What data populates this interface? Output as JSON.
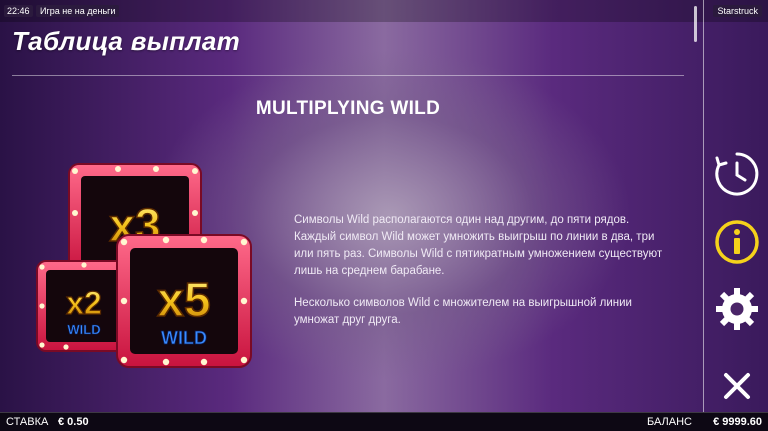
{
  "status": {
    "time": "22:46",
    "mode": "Игра не на деньги",
    "game_name": "Starstruck"
  },
  "header": {
    "title": "Таблица выплат"
  },
  "section": {
    "heading": "MULTIPLYING WILD",
    "paragraph_1": "Символы Wild располагаются один над другим, до пяти рядов. Каждый символ Wild может умножить выигрыш по линии в два, три или пять раз. Символы Wild с пятикратным умножением существуют лишь на среднем барабане.",
    "paragraph_2": "Несколько символов Wild с множителем на выигрышной линии умножат друг друга."
  },
  "symbols": [
    {
      "multiplier": "x3",
      "label": "WILD"
    },
    {
      "multiplier": "x2",
      "label": "WILD"
    },
    {
      "multiplier": "x5",
      "label": "WILD"
    }
  ],
  "sidebar": {
    "icons": [
      "clock-icon",
      "info-icon",
      "gear-icon",
      "close-icon"
    ],
    "accent": "#f5d21b"
  },
  "footer": {
    "bet_label": "СТАВКА",
    "bet_value": "€ 0.50",
    "balance_label": "БАЛАНС",
    "balance_value": "€ 9999.60"
  }
}
